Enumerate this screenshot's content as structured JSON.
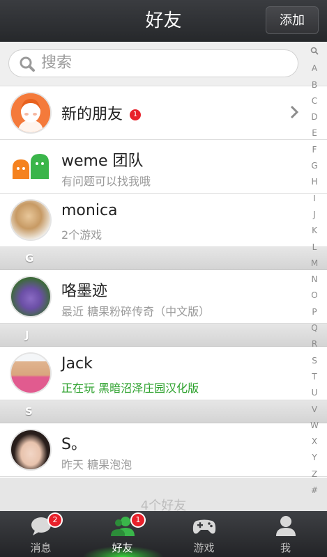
{
  "header": {
    "title": "好友",
    "add_label": "添加"
  },
  "search": {
    "placeholder": "搜索"
  },
  "rows": {
    "new_friends": {
      "name": "新的朋友",
      "badge": "1"
    },
    "weme": {
      "name": "weme 团队",
      "sub": "有问题可以找我哦"
    },
    "monica": {
      "name": "monica",
      "sub": "2个游戏"
    },
    "gemoji": {
      "name": "咯墨迹",
      "sub": "最近 糖果粉碎传奇（中文版）"
    },
    "jack": {
      "name": "Jack",
      "sub": "正在玩 黑暗沼泽庄园汉化版"
    },
    "s": {
      "name": "S。",
      "sub": "昨天 糖果泡泡"
    }
  },
  "sections": {
    "g": "G",
    "j": "J",
    "s": "S"
  },
  "index_letters": [
    "A",
    "B",
    "C",
    "D",
    "E",
    "F",
    "G",
    "H",
    "I",
    "J",
    "K",
    "L",
    "M",
    "N",
    "O",
    "P",
    "Q",
    "R",
    "S",
    "T",
    "U",
    "V",
    "W",
    "X",
    "Y",
    "Z",
    "#"
  ],
  "footer": {
    "count_text": "4个好友"
  },
  "tabs": {
    "messages": {
      "label": "消息",
      "badge": "2"
    },
    "friends": {
      "label": "好友",
      "badge": "1"
    },
    "games": {
      "label": "游戏"
    },
    "me": {
      "label": "我"
    }
  },
  "colors": {
    "header_bg": "#2f3134",
    "badge_red": "#e8212b",
    "playing_green": "#2aa02a",
    "active_glow": "#39d23c"
  }
}
